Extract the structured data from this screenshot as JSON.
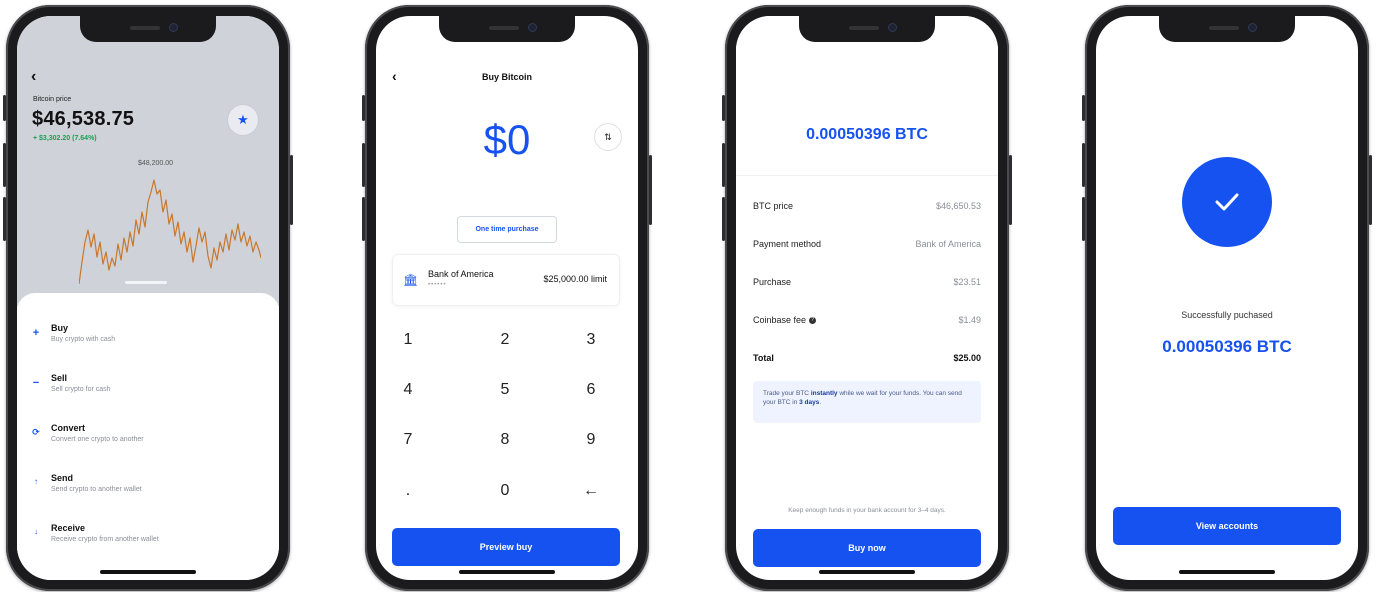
{
  "colors": {
    "brand_blue": "#1652f0",
    "positive_green": "#1e9e55",
    "chart_orange": "#c8782c"
  },
  "price_screen": {
    "back_icon": "chevron-left-icon",
    "price_label": "Bitcoin price",
    "price": "$46,538.75",
    "change": "+ $3,302.20 (7.64%)",
    "favorite_icon": "star-icon",
    "chart_high_label": "$48,200.00",
    "actions": [
      {
        "icon": "plus-icon",
        "title": "Buy",
        "subtitle": "Buy crypto with cash"
      },
      {
        "icon": "minus-icon",
        "title": "Sell",
        "subtitle": "Sell crypto for cash"
      },
      {
        "icon": "convert-icon",
        "title": "Convert",
        "subtitle": "Convert one crypto to another"
      },
      {
        "icon": "arrow-up-icon",
        "title": "Send",
        "subtitle": "Send crypto to another wallet"
      },
      {
        "icon": "arrow-down-icon",
        "title": "Receive",
        "subtitle": "Receive crypto from another wallet"
      }
    ]
  },
  "buy_screen": {
    "back_icon": "chevron-left-icon",
    "title": "Buy Bitcoin",
    "amount": "$0",
    "swap_icon": "swap-icon",
    "frequency": "One time purchase",
    "bank": {
      "icon": "bank-icon",
      "name": "Bank of America",
      "mask": "••••••",
      "limit": "$25,000.00 limit"
    },
    "keypad": [
      "1",
      "2",
      "3",
      "4",
      "5",
      "6",
      "7",
      "8",
      "9",
      ".",
      "0",
      "←"
    ],
    "cta": "Preview buy"
  },
  "preview_screen": {
    "btc_amount": "0.00050396 BTC",
    "rows": [
      {
        "label": "BTC price",
        "value": "$46,650.53"
      },
      {
        "label": "Payment method",
        "value": "Bank of America"
      },
      {
        "label": "Purchase",
        "value": "$23.51"
      },
      {
        "label": "Coinbase fee",
        "value": "$1.49",
        "info_icon": "info-icon"
      },
      {
        "label": "Total",
        "value": "$25.00"
      }
    ],
    "note": {
      "part1": "Trade your BTC ",
      "bold1": "instantly",
      "part2": " while we wait for your funds. You can send your BTC in ",
      "bold2": "3 days",
      "part3": "."
    },
    "footer_note": "Keep enough funds in your bank account for 3–4 days.",
    "cta": "Buy now"
  },
  "success_screen": {
    "icon": "checkmark-icon",
    "message": "Successfully puchased",
    "btc_amount": "0.00050396 BTC",
    "cta": "View accounts"
  }
}
